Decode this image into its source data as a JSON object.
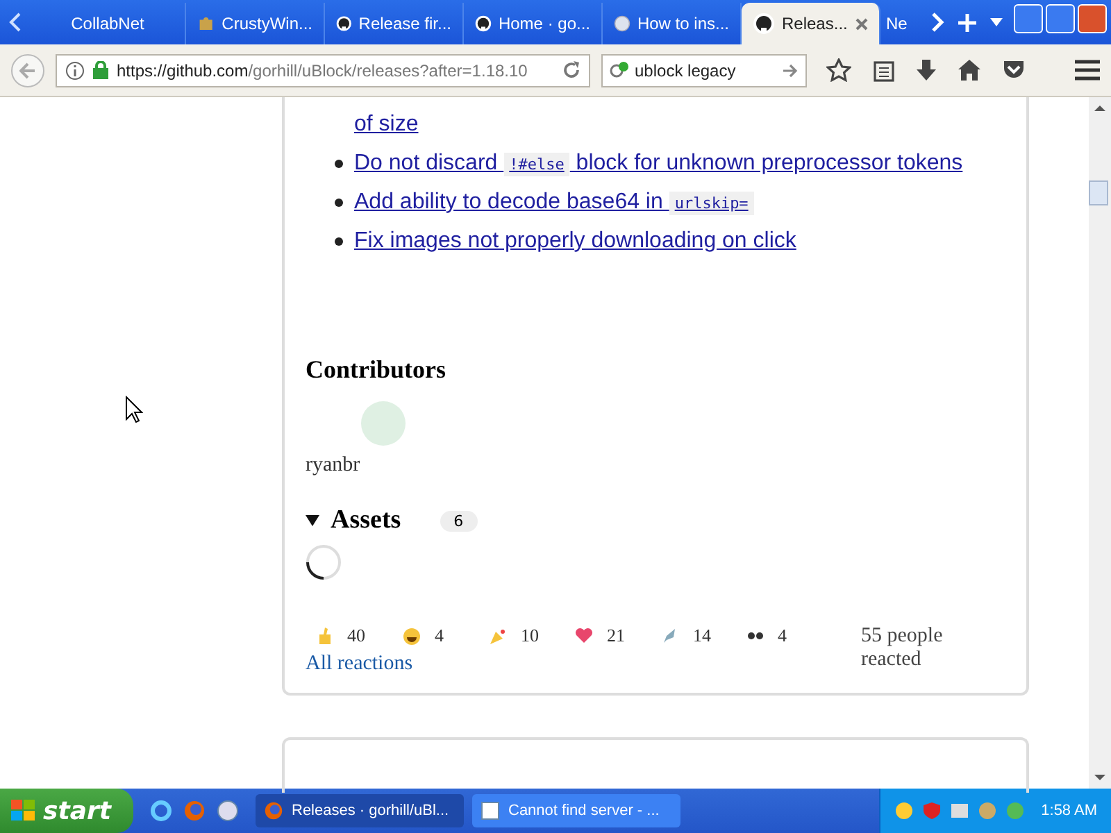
{
  "browser": {
    "tabs": [
      {
        "label": "CollabNet",
        "kind": "none",
        "selected": false
      },
      {
        "label": "CrustyWin...",
        "kind": "puzzle",
        "selected": false
      },
      {
        "label": "Release fir...",
        "kind": "octocat",
        "selected": false
      },
      {
        "label": "Home · go...",
        "kind": "octocat",
        "selected": false
      },
      {
        "label": "How to ins...",
        "kind": "globe",
        "selected": false
      },
      {
        "label": "Releas...",
        "kind": "octocat",
        "selected": true
      },
      {
        "label": "Ne",
        "kind": "none",
        "selected": false
      }
    ],
    "url": {
      "host": "https://github.com",
      "path": "/gorhill/uBlock/releases?after=1.18.10"
    },
    "search": {
      "value": "ublock legacy"
    }
  },
  "release": {
    "changes": [
      {
        "kind": "continuation",
        "segments": [
          {
            "kind": "text",
            "text": "of size"
          }
        ]
      },
      {
        "kind": "item",
        "segments": [
          {
            "kind": "text",
            "text": "Do not discard "
          },
          {
            "kind": "code",
            "text": "!#else"
          },
          {
            "kind": "text",
            "text": " block for unknown preprocessor tokens"
          }
        ]
      },
      {
        "kind": "item",
        "segments": [
          {
            "kind": "text",
            "text": "Add ability to decode base64 in "
          },
          {
            "kind": "code",
            "text": "urlskip="
          }
        ]
      },
      {
        "kind": "item",
        "segments": [
          {
            "kind": "text",
            "text": "Fix images not properly downloading on click"
          }
        ]
      }
    ],
    "contributors": {
      "title": "Contributors",
      "people": [
        {
          "name": "ryanbr"
        }
      ]
    },
    "assets": {
      "title": "Assets",
      "count": "6",
      "expanded": true
    },
    "reactions": [
      {
        "kind": "thumbs",
        "count": "40"
      },
      {
        "kind": "laugh",
        "count": "4"
      },
      {
        "kind": "hooray",
        "count": "10"
      },
      {
        "kind": "heart",
        "count": "21"
      },
      {
        "kind": "rocket",
        "count": "14"
      },
      {
        "kind": "eyes",
        "count": "4"
      }
    ],
    "reacted": "55 people reacted",
    "all_reactions": "All reactions"
  },
  "taskbar": {
    "start": "start",
    "tasks": [
      {
        "label": "Releases · gorhill/uBl...",
        "kind": "firefox",
        "selected": true
      },
      {
        "label": "Cannot find server - ...",
        "kind": "page",
        "selected": false
      }
    ],
    "clock": "1:58 AM"
  }
}
